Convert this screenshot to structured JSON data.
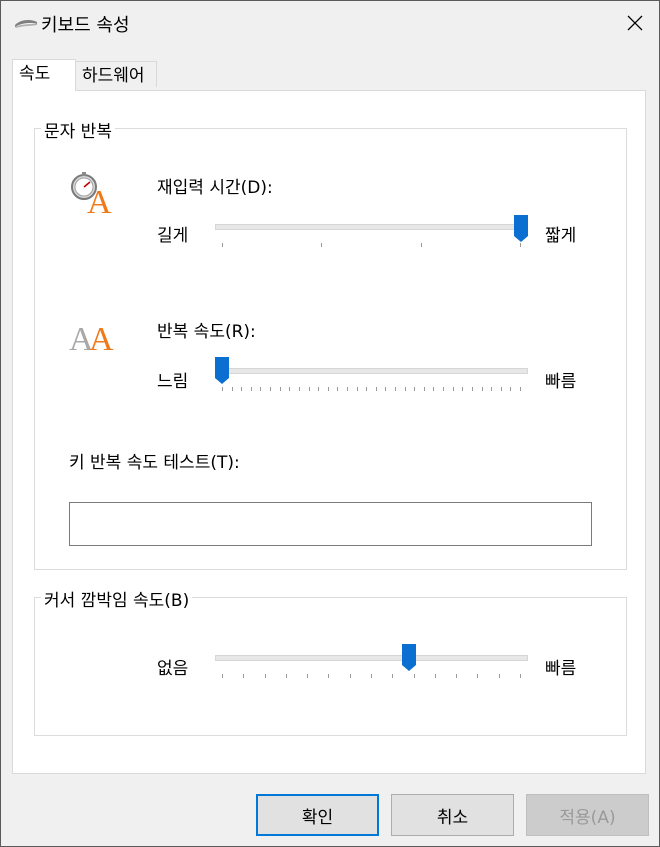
{
  "window": {
    "title": "키보드 속성"
  },
  "tabs": [
    {
      "label": "속도",
      "active": true
    },
    {
      "label": "하드웨어",
      "active": false
    }
  ],
  "char_repeat": {
    "group_label": "문자 반복",
    "delay": {
      "label": "재입력 시간(D):",
      "min_label": "길게",
      "max_label": "짧게",
      "value": 1.0,
      "tick_count": 4
    },
    "rate": {
      "label": "반복 속도(R):",
      "min_label": "느림",
      "max_label": "빠름",
      "value": 0.0,
      "tick_count": 32
    },
    "test": {
      "label": "키 반복 속도 테스트(T):",
      "value": ""
    }
  },
  "cursor_blink": {
    "group_label": "커서 깜박임 속도(B)",
    "min_label": "없음",
    "max_label": "빠름",
    "value": 0.625,
    "tick_count": 15
  },
  "buttons": {
    "ok": "확인",
    "cancel": "취소",
    "apply": "적용(A)"
  },
  "colors": {
    "accent": "#0078d7",
    "thumb": "#0a6fd0"
  }
}
